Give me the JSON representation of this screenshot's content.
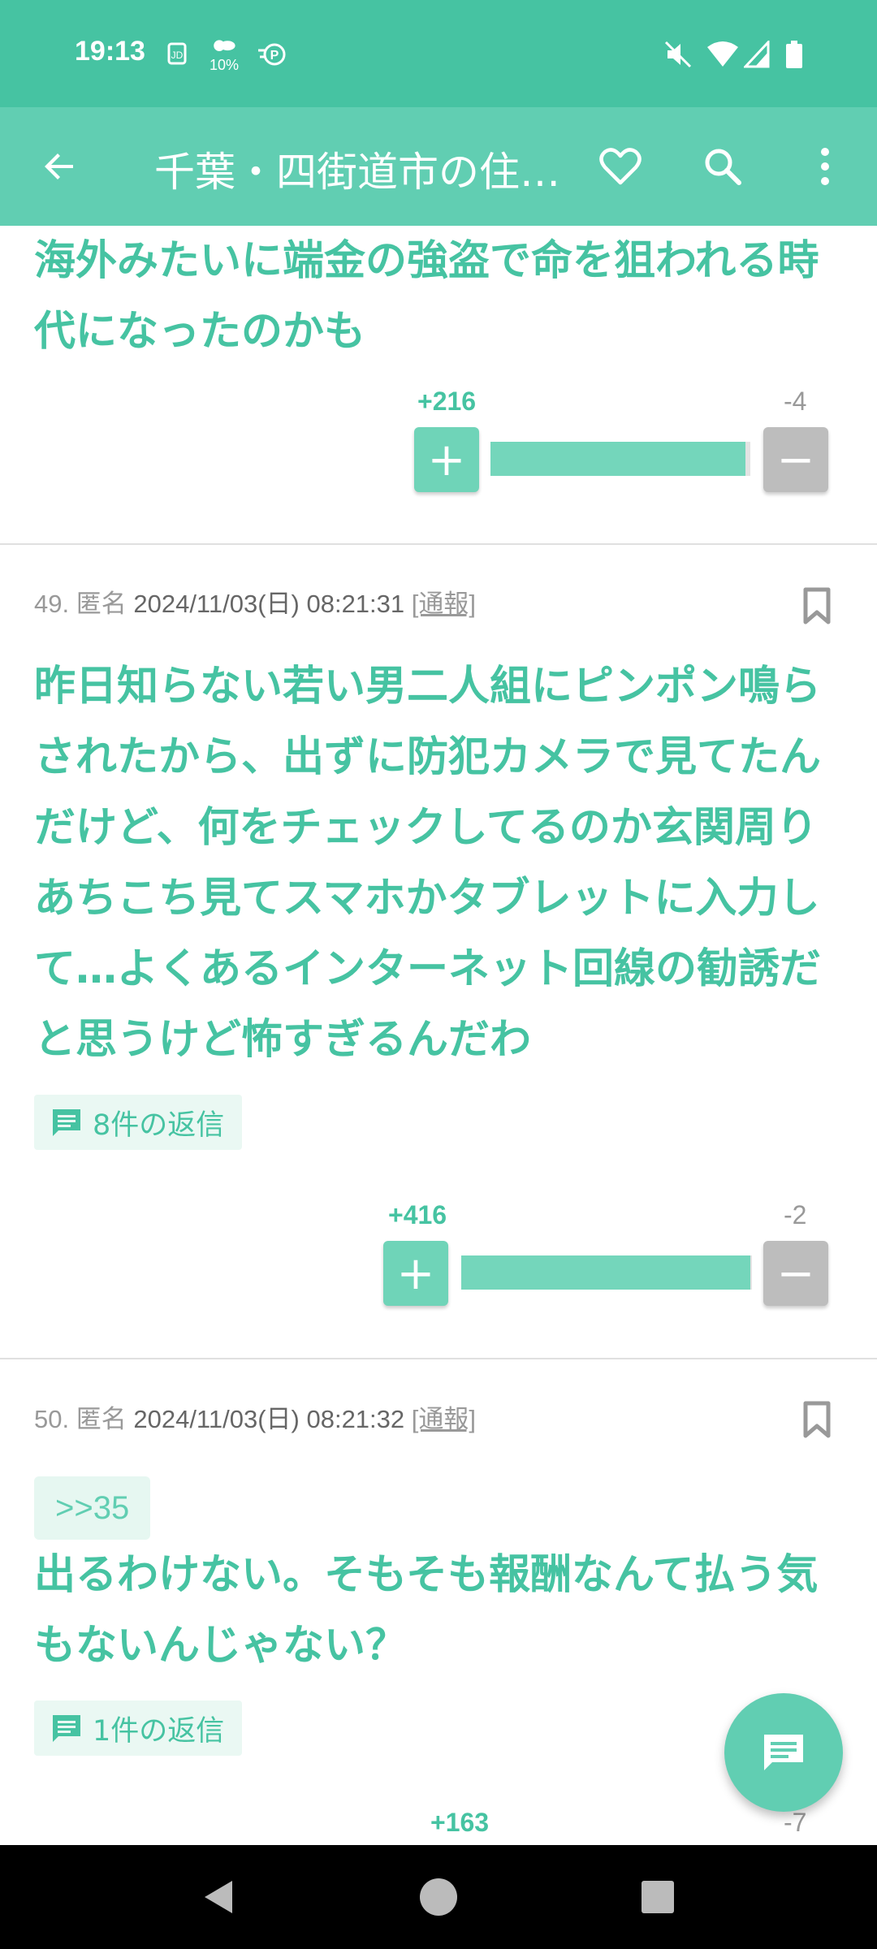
{
  "status_bar": {
    "time": "19:13",
    "icons": [
      "jd-app-icon",
      "weather-icon",
      "rakuten-point-icon",
      "mute-icon",
      "wifi-icon",
      "signal-icon",
      "battery-icon"
    ],
    "weather_text": "10%"
  },
  "app_bar": {
    "title": "千葉・四街道市の住…",
    "back_icon": "arrow-back-icon",
    "favorite_icon": "heart-icon",
    "search_icon": "search-icon",
    "menu_icon": "more-vert-icon"
  },
  "comments": [
    {
      "body": "海外みたいに端金の強盗で命を狙われる時代になったのかも",
      "plus": "+216",
      "minus": "-4",
      "ratio": 0.98
    },
    {
      "number": "49.",
      "author": "匿名",
      "date": "2024/11/03(日) 08:21:31",
      "report": "[通報]",
      "body": "昨日知らない若い男二人組にピンポン鳴らされたから、出ずに防犯カメラで見てたんだけど、何をチェックしてるのか玄関周りあちこち見てスマホかタブレットに入力して…よくあるインターネット回線の勧誘だと思うけど怖すぎるんだわ",
      "replies": "8件の返信",
      "plus": "+416",
      "minus": "-2",
      "ratio": 0.995
    },
    {
      "number": "50.",
      "author": "匿名",
      "date": "2024/11/03(日) 08:21:32",
      "report": "[通報]",
      "anchor": ">>35",
      "body": "出るわけない。そもそも報酬なんて払う気もないんじゃない？",
      "replies": "1件の返信",
      "plus": "+163",
      "minus": "-7"
    }
  ],
  "fab": {
    "icon": "comment-icon"
  },
  "nav_bar": {
    "icons": [
      "nav-back-icon",
      "nav-home-icon",
      "nav-recents-icon"
    ]
  },
  "colors": {
    "accent": "#46c3a2",
    "app_bar": "#61ceb2",
    "status_bar": "#46c3a2"
  }
}
